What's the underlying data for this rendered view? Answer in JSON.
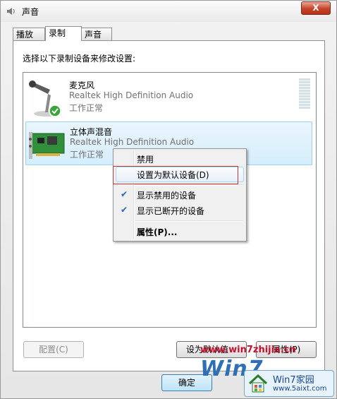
{
  "window": {
    "title": "声音",
    "close_label": "X"
  },
  "tabs": [
    {
      "label": "播放",
      "active": false
    },
    {
      "label": "录制",
      "active": true
    },
    {
      "label": "声音",
      "active": false
    }
  ],
  "panel": {
    "instruction": "选择以下录制设备来修改设置:"
  },
  "devices": [
    {
      "name": "麦克风",
      "driver": "Realtek High Definition Audio",
      "status": "工作正常",
      "icon": "microphone-icon",
      "default_badge": "check-icon",
      "selected": false
    },
    {
      "name": "立体声混音",
      "driver": "Realtek High Definition Audio",
      "status": "工作正常",
      "icon": "sound-card-icon",
      "selected": true
    }
  ],
  "context_menu": {
    "items": [
      {
        "label": "禁用",
        "checked": false
      },
      {
        "label": "设置为默认设备(D)",
        "checked": false,
        "hovered": true
      },
      {
        "label": "显示禁用的设备",
        "checked": true
      },
      {
        "label": "显示已断开的设备",
        "checked": true
      },
      {
        "label": "属性(P)...",
        "checked": false,
        "bold": true
      }
    ]
  },
  "buttons": {
    "configure": "配置(C)",
    "set_default": "设为默认值",
    "properties": "属性(P)",
    "ok": "确定"
  },
  "watermark": {
    "url": "www.win7zhijia.cn",
    "logo_text": "Win7",
    "badge_title": "Win7家园",
    "badge_url": "www.5aixt.com"
  },
  "colors": {
    "accent": "#3399ff",
    "highlight_border": "#c0383a",
    "watermark_red": "#c8102e"
  }
}
